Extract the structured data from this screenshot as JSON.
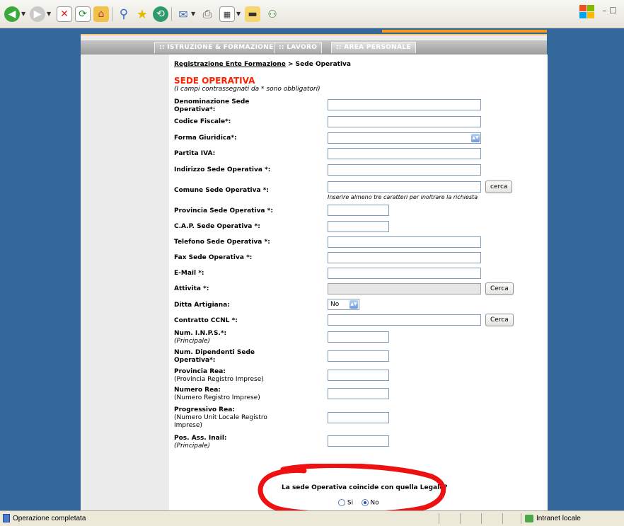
{
  "browser": {
    "toolbar_icons": [
      "back-icon",
      "forward-icon",
      "stop-icon",
      "refresh-icon",
      "home-icon",
      "search-icon",
      "favorites-icon",
      "history-icon",
      "mail-icon",
      "print-icon",
      "edit-icon",
      "discuss-icon",
      "messenger-icon"
    ],
    "window_controls": "– ☐"
  },
  "nav": {
    "tabs": [
      ":: ISTRUZIONE & FORMAZIONE",
      ":: LAVORO",
      ":: AREA PERSONALE"
    ]
  },
  "breadcrumb": {
    "link": "Registrazione Ente Formazione",
    "separator": " > ",
    "current": "Sede Operativa"
  },
  "form": {
    "title": "SEDE OPERATIVA",
    "note": "(I campi contrassegnati da * sono obbligatori)",
    "fields": {
      "denominazione": "Denominazione Sede Operativa*:",
      "codice_fiscale": "Codice Fiscale*:",
      "forma_giuridica": "Forma Giuridica*:",
      "partita_iva": "Partita IVA:",
      "indirizzo": "Indirizzo Sede Operativa *:",
      "comune": "Comune Sede Operativa *:",
      "comune_hint": "Inserire almeno tre caratteri per inoltrare la richiesta",
      "provincia": "Provincia Sede Operativa *:",
      "cap": "C.A.P. Sede Operativa *:",
      "telefono": "Telefono Sede Operativa *:",
      "fax": "Fax Sede Operativa *:",
      "email": "E-Mail *:",
      "attivita": "Attivita *:",
      "ditta_artigiana": "Ditta Artigiana:",
      "ditta_artigiana_value": "No",
      "contratto_ccnl": "Contratto CCNL *:",
      "num_inps": "Num. I.N.P.S.*:",
      "num_inps_sub": "(Principale)",
      "num_dipendenti": "Num. Dipendenti Sede Operativa*:",
      "provincia_rea": "Provincia Rea:",
      "provincia_rea_sub": "(Provincia Registro Imprese)",
      "numero_rea": "Numero Rea:",
      "numero_rea_sub": "(Numero Registro Imprese)",
      "progressivo_rea": "Progressivo Rea:",
      "progressivo_rea_sub": "(Numero Unit Locale Registro Imprese)",
      "pos_inail": "Pos. Ass. Inail:",
      "pos_inail_sub": "(Principale)"
    },
    "buttons": {
      "cerca_comune": "cerca",
      "cerca_attivita": "Cerca",
      "cerca_ccnl": "Cerca"
    },
    "question": "La sede Operativa coincide con quella Legale?",
    "radio": {
      "si": "Si",
      "no": "No",
      "selected": "No"
    }
  },
  "status": {
    "text": "Operazione completata",
    "zone": "Intranet locale"
  },
  "colors": {
    "page_bg": "#336699",
    "title_red": "#ff2200",
    "accent_orange": "#f39a1e",
    "annotation_red": "#ee1111"
  }
}
